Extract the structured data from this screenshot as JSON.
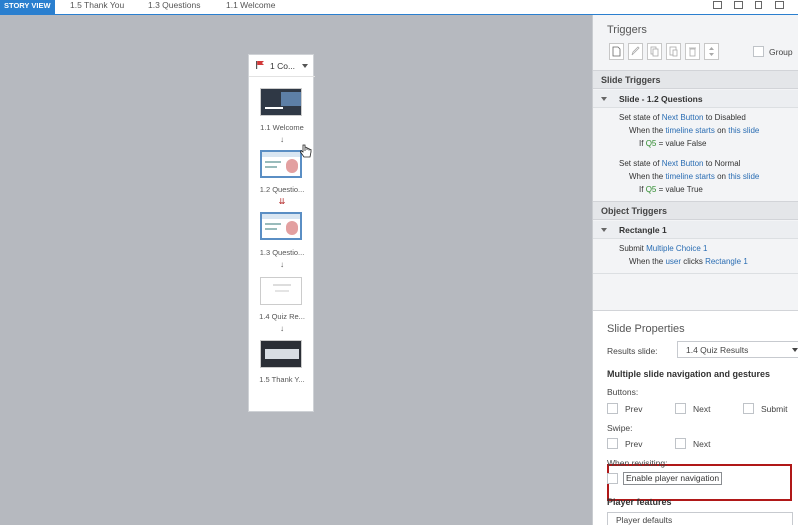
{
  "tabs": [
    "STORY VIEW",
    "1.5 Thank You",
    "1.3 Questions",
    "1.1 Welcome"
  ],
  "scene": {
    "title": "1 Co...",
    "slides": [
      "1.1 Welcome",
      "1.2 Questio...",
      "1.3 Questio...",
      "1.4 Quiz Re...",
      "1.5 Thank Y..."
    ],
    "arrow": "↓",
    "double_arrow": "⇊"
  },
  "triggers": {
    "title": "Triggers",
    "group_label": "Group",
    "slide_triggers_label": "Slide Triggers",
    "slide_group": "Slide - 1.2 Questions",
    "t1": {
      "set": "Set state of",
      "obj": "Next Button",
      "to": "to Disabled",
      "when": "When the",
      "event": "timeline starts",
      "on": "on",
      "target": "this slide",
      "if": "If",
      "var": "Q5",
      "cond": "= value",
      "val": "False"
    },
    "t2": {
      "set": "Set state of",
      "obj": "Next Button",
      "to": "to Normal",
      "when": "When the",
      "event": "timeline starts",
      "on": "on",
      "target": "this slide",
      "if": "If",
      "var": "Q5",
      "cond": "= value",
      "val": "True"
    },
    "object_triggers_label": "Object Triggers",
    "object_group": "Rectangle 1",
    "t3": {
      "action": "Submit",
      "obj": "Multiple Choice 1",
      "when": "When the",
      "who": "user",
      "event": "clicks",
      "target": "Rectangle 1"
    }
  },
  "slide_properties": {
    "title": "Slide Properties",
    "results_slide_label": "Results slide:",
    "results_slide_value": "1.4 Quiz Results",
    "nav_heading": "Multiple slide navigation and gestures",
    "buttons_label": "Buttons:",
    "prev": "Prev",
    "next": "Next",
    "submit": "Submit",
    "swipe_label": "Swipe:",
    "swipe_prev": "Prev",
    "swipe_next": "Next",
    "revisiting_label": "When revisiting:",
    "enable_player_nav": "Enable player navigation",
    "player_features": "Player features",
    "player_defaults": "Player defaults"
  },
  "colors": {
    "accent": "#2a7fcf",
    "highlight": "#b01818",
    "link": "#2a6db3",
    "variable": "#2e8b2e"
  }
}
